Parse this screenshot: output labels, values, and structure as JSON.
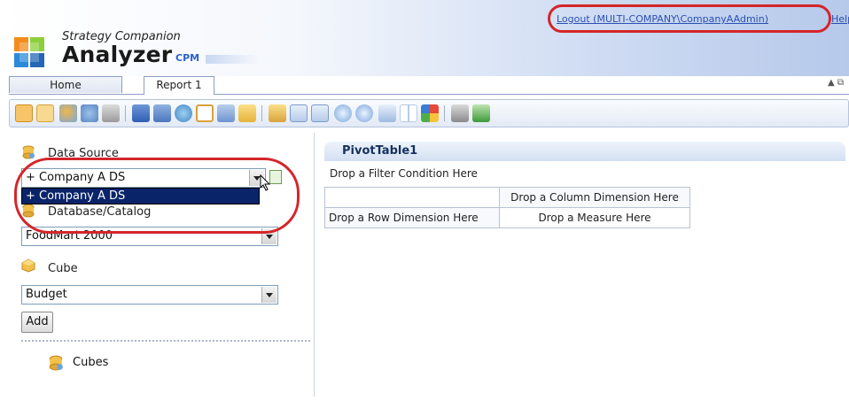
{
  "header": {
    "logout_label": "Logout (MULTI-COMPANY\\CompanyAAdmin)",
    "help_label": "Help",
    "brand_sub": "Strategy Companion",
    "brand_main": "Analyzer",
    "brand_cpm": "CPM"
  },
  "tabs": [
    {
      "label": "Home"
    },
    {
      "label": "Report 1"
    }
  ],
  "tab_tools": "▲ ⧉",
  "toolbar_icons": [
    "select-icon",
    "table-icon",
    "dimension-icon",
    "measure-icon",
    "calc-icon",
    "save-icon",
    "save-as-icon",
    "refresh-icon",
    "window-icon",
    "copy-icon",
    "open-folder-icon",
    "export-icon",
    "filter-icon",
    "report-icon",
    "zoom-in-icon",
    "zoom-out-icon",
    "grid-icon",
    "layout-icon",
    "color-icon",
    "print-icon",
    "excel-icon"
  ],
  "left": {
    "data_source_label": "Data Source",
    "data_source_value": "+ Company A DS",
    "data_source_option": "+ Company A DS",
    "database_label": "Database/Catalog",
    "database_value": "FoodMart 2000",
    "cube_label": "Cube",
    "cube_value": "Budget",
    "add_label": "Add",
    "tree_item": "Cubes"
  },
  "pivot": {
    "title": "PivotTable1",
    "filter_drop": "Drop a Filter Condition Here",
    "column_drop": "Drop a Column Dimension Here",
    "row_drop": "Drop a Row Dimension Here",
    "measure_drop": "Drop a Measure Here"
  },
  "colors": {
    "highlight_oval": "#d4252a",
    "selection": "#0a246a",
    "link": "#2b4fb3"
  }
}
